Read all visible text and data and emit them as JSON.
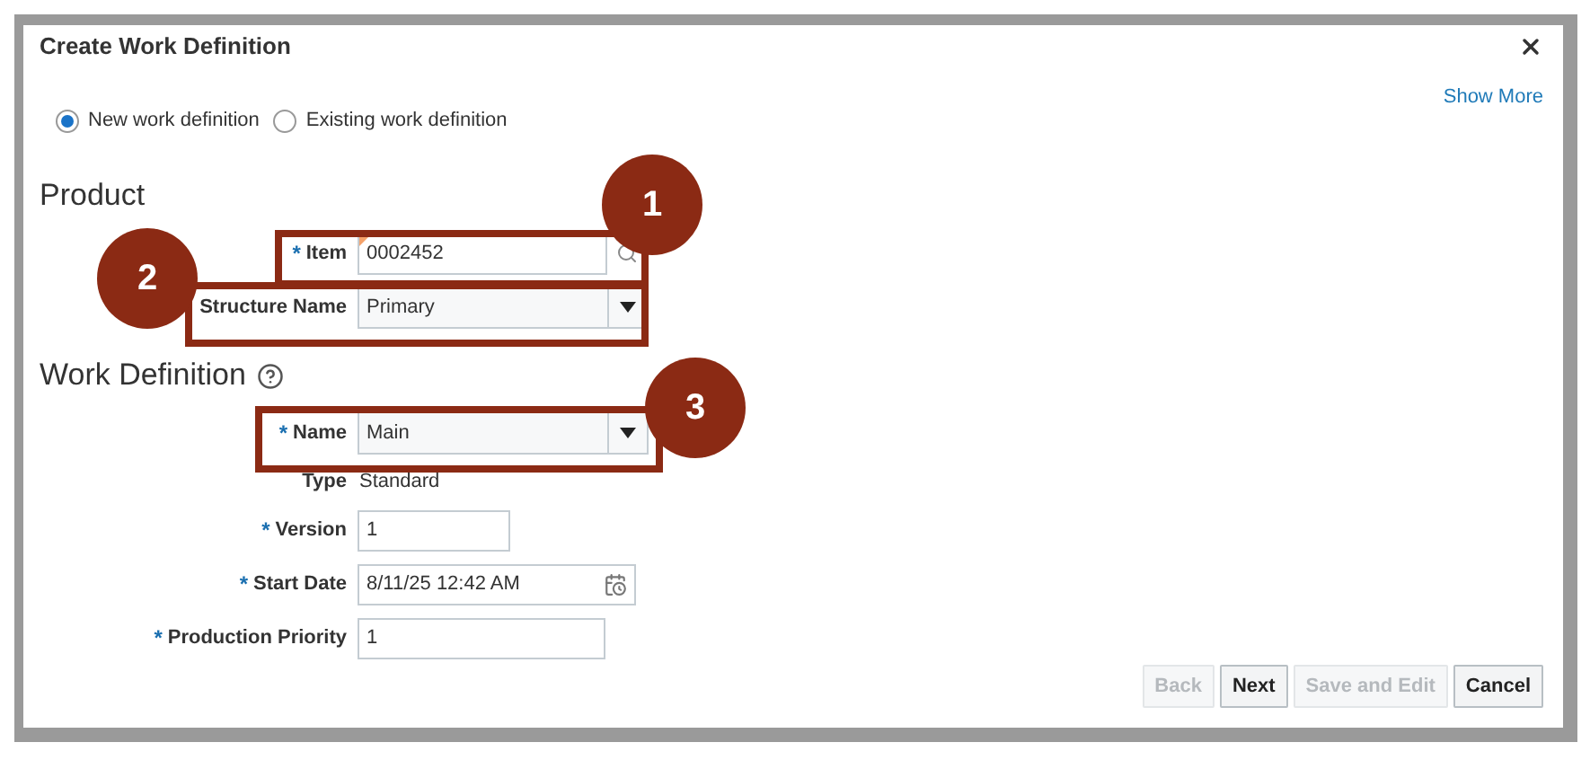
{
  "dialog": {
    "title": "Create Work Definition"
  },
  "mode_options": [
    {
      "label": "New work definition",
      "selected": true
    },
    {
      "label": "Existing work definition",
      "selected": false
    }
  ],
  "show_more": "Show More",
  "sections": [
    {
      "title": "Product",
      "help": false,
      "fields": [
        {
          "kind": "lookup",
          "label": "Item",
          "required_mark": "*",
          "changed": true,
          "value": "0002452"
        },
        {
          "kind": "select",
          "label": "Structure Name",
          "value": "Primary"
        }
      ]
    },
    {
      "title": "Work Definition",
      "help": true,
      "fields": [
        {
          "kind": "select",
          "label": "Name",
          "required_mark": "*",
          "value": "Main"
        },
        {
          "kind": "text",
          "label": "Type",
          "value": "Standard"
        },
        {
          "kind": "input",
          "label": "Version",
          "required_mark": "*",
          "value": "1"
        },
        {
          "kind": "date",
          "label": "Start Date",
          "required_mark": "*",
          "value": "8/11/25 12:42 AM"
        },
        {
          "kind": "input",
          "label": "Production Priority",
          "required_mark": "*",
          "value": "1"
        }
      ]
    }
  ],
  "buttons": [
    {
      "label": "Back",
      "disabled": true
    },
    {
      "label": "Next",
      "disabled": false
    },
    {
      "label": "Save and Edit",
      "disabled": true
    },
    {
      "label": "Cancel",
      "disabled": false
    }
  ],
  "callouts": [
    {
      "label": "1"
    },
    {
      "label": "2"
    },
    {
      "label": "3"
    }
  ]
}
